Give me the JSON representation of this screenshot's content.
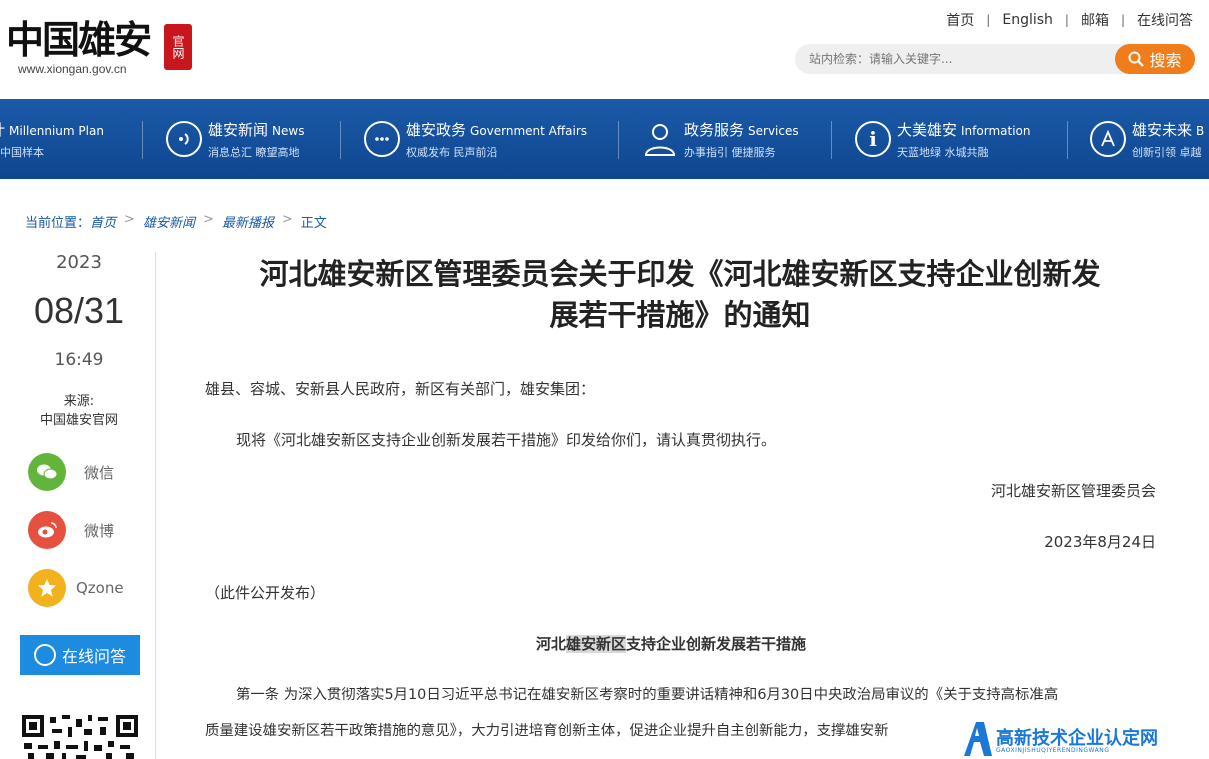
{
  "logo": {
    "text": "中国雄安",
    "url": "www.xiongan.gov.cn",
    "seal": "官网"
  },
  "top_links": [
    "首页",
    "English",
    "邮箱",
    "在线问答"
  ],
  "search": {
    "placeholder": "站内检索：请输入关键字...",
    "button": "搜索"
  },
  "nav": [
    {
      "title": "计",
      "en": "Millennium Plan",
      "sub": "中国样本",
      "icon": "plan-icon"
    },
    {
      "title": "雄安新闻",
      "en": "News",
      "sub": "消息总汇 瞭望高地",
      "icon": "news-icon"
    },
    {
      "title": "雄安政务",
      "en": "Government Affairs",
      "sub": "权威发布 民声前沿",
      "icon": "chat-icon"
    },
    {
      "title": "政务服务",
      "en": "Services",
      "sub": "办事指引 便捷服务",
      "icon": "person-icon"
    },
    {
      "title": "大美雄安",
      "en": "Information",
      "sub": "天蓝地绿 水城共融",
      "icon": "info-icon"
    },
    {
      "title": "雄安未来",
      "en": "B",
      "sub": "创新引领 卓越",
      "icon": "future-icon"
    }
  ],
  "breadcrumb": {
    "label": "当前位置：",
    "items": [
      "首页",
      "雄安新闻",
      "最新播报",
      "正文"
    ]
  },
  "date": {
    "year": "2023",
    "md": "08/31",
    "time": "16:49"
  },
  "source": {
    "label": "来源:",
    "value": "中国雄安官网"
  },
  "share": [
    {
      "label": "微信",
      "color": "#62b53a",
      "icon": "wechat-icon"
    },
    {
      "label": "微博",
      "color": "#e6503e",
      "icon": "weibo-icon"
    },
    {
      "label": "Qzone",
      "color": "#f2b21e",
      "icon": "qzone-icon"
    }
  ],
  "qa_button": "在线问答",
  "article": {
    "title_line1": "河北雄安新区管理委员会关于印发《河北雄安新区支持企业创新发",
    "title_line2": "展若干措施》的通知",
    "salutation": "雄县、容城、安新县人民政府，新区有关部门，雄安集团：",
    "body1": "现将《河北雄安新区支持企业创新发展若干措施》印发给你们，请认真贯彻执行。",
    "signer": "河北雄安新区管理委员会",
    "sign_date": "2023年8月24日",
    "note": "（此件公开发布）",
    "subtitle_a": "河北",
    "subtitle_hl": "雄安新区",
    "subtitle_b": "支持企业创新发展若干措施",
    "art1_line1": "第一条 为深入贯彻落实5月10日习近平总书记在雄安新区考察时的重要讲话精神和6月30日中央政治局审议的《关于支持高标准高",
    "art1_line2": "质量建设雄安新区若干政策措施的意见》，大力引进培育创新主体，促进企业提升自主创新能力，支撑雄安新"
  },
  "watermark": {
    "text": "高新技术企业认定网",
    "sub": "GAOXINJISHUQIYERENDINGWANG"
  },
  "colors": {
    "nav_blue": "#1b5aa8",
    "accent_orange": "#f07d1a",
    "link_blue": "#1a5aa6",
    "qa_blue": "#1c8be0"
  }
}
